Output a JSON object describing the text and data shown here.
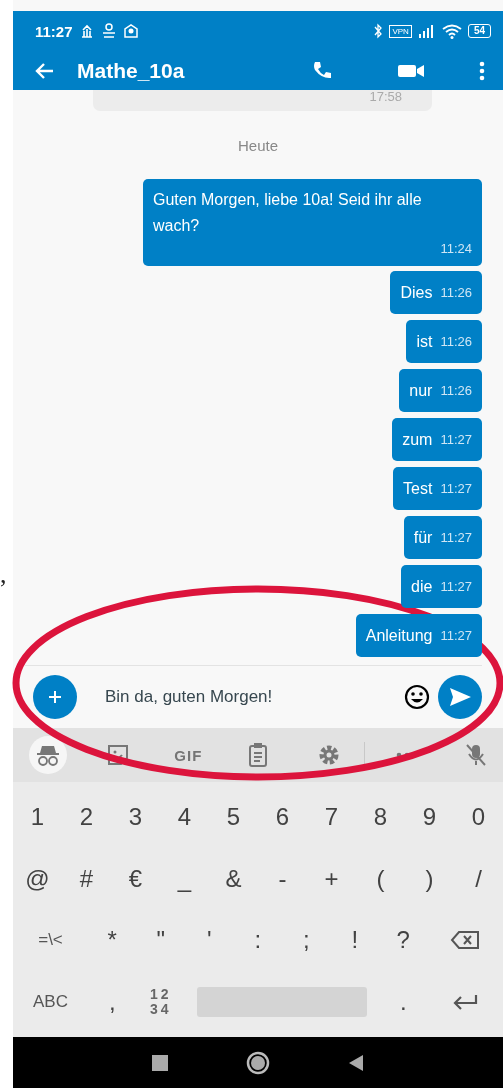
{
  "margin_mark": ",",
  "status_bar": {
    "time": "11:27",
    "vpn": "VPN",
    "battery": "54"
  },
  "header": {
    "title": "Mathe_10a"
  },
  "messages": [
    {
      "kind": "incoming",
      "time": "17:58"
    },
    {
      "kind": "date",
      "text": "Heute"
    },
    {
      "kind": "outgoing",
      "text": "Guten Morgen, liebe 10a! Seid ihr alle wach?",
      "time": "11:24"
    },
    {
      "kind": "outgoing",
      "text": "Dies",
      "time": "11:26"
    },
    {
      "kind": "outgoing",
      "text": "ist",
      "time": "11:26"
    },
    {
      "kind": "outgoing",
      "text": "nur",
      "time": "11:26"
    },
    {
      "kind": "outgoing",
      "text": "zum",
      "time": "11:27"
    },
    {
      "kind": "outgoing",
      "text": "Test",
      "time": "11:27"
    },
    {
      "kind": "outgoing",
      "text": "für",
      "time": "11:27"
    },
    {
      "kind": "outgoing",
      "text": "die",
      "time": "11:27"
    },
    {
      "kind": "outgoing",
      "text": "Anleitung",
      "time": "11:27"
    }
  ],
  "composer": {
    "value": "Bin da, guten Morgen!"
  },
  "keyboard_toolbar": {
    "gif": "GIF"
  },
  "keyboard": {
    "rows": [
      [
        {
          "kind": "char",
          "label": "1"
        },
        {
          "kind": "char",
          "label": "2"
        },
        {
          "kind": "char",
          "label": "3"
        },
        {
          "kind": "char",
          "label": "4"
        },
        {
          "kind": "char",
          "label": "5"
        },
        {
          "kind": "char",
          "label": "6"
        },
        {
          "kind": "char",
          "label": "7"
        },
        {
          "kind": "char",
          "label": "8"
        },
        {
          "kind": "char",
          "label": "9"
        },
        {
          "kind": "char",
          "label": "0"
        }
      ],
      [
        {
          "kind": "char",
          "label": "@"
        },
        {
          "kind": "char",
          "label": "#"
        },
        {
          "kind": "char",
          "label": "€"
        },
        {
          "kind": "char",
          "label": "_"
        },
        {
          "kind": "char",
          "label": "&"
        },
        {
          "kind": "char",
          "label": "-"
        },
        {
          "kind": "char",
          "label": "+"
        },
        {
          "kind": "char",
          "label": "("
        },
        {
          "kind": "char",
          "label": ")"
        },
        {
          "kind": "char",
          "label": "/"
        }
      ],
      [
        {
          "kind": "mode",
          "label": "=\\<"
        },
        {
          "kind": "char",
          "label": "*"
        },
        {
          "kind": "char",
          "label": "\""
        },
        {
          "kind": "char",
          "label": "'"
        },
        {
          "kind": "char",
          "label": ":"
        },
        {
          "kind": "char",
          "label": ";"
        },
        {
          "kind": "char",
          "label": "!"
        },
        {
          "kind": "char",
          "label": "?"
        },
        {
          "kind": "backspace"
        }
      ],
      [
        {
          "kind": "mode",
          "label": "ABC"
        },
        {
          "kind": "char",
          "label": ","
        },
        {
          "kind": "mode2",
          "label": "12\n34"
        },
        {
          "kind": "space"
        },
        {
          "kind": "char",
          "label": "."
        },
        {
          "kind": "enter"
        }
      ]
    ]
  }
}
